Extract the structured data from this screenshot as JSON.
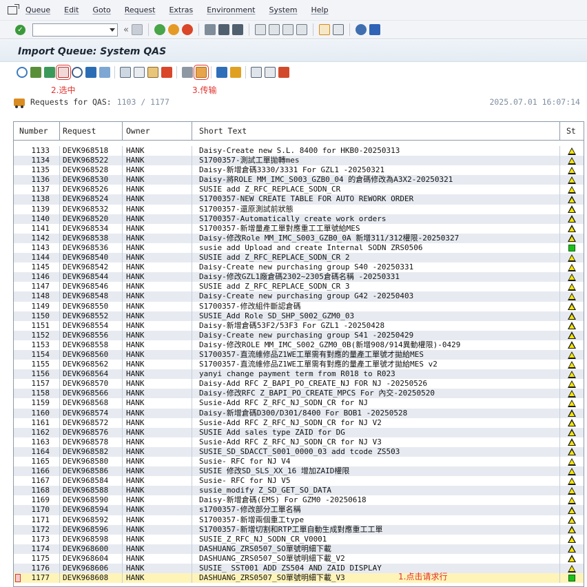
{
  "menu": [
    "Queue",
    "Edit",
    "Goto",
    "Request",
    "Extras",
    "Environment",
    "System",
    "Help"
  ],
  "toolbar": {
    "command_value": "",
    "back_glyph": "«"
  },
  "screen_title": "Import Queue: System QAS",
  "annotations": {
    "select": "2.选中",
    "transport": "3.传输",
    "click_row": "1.点击请求行"
  },
  "requests_line": {
    "label": "Requests for QAS:",
    "count": "1103 / 1177"
  },
  "timestamp": "2025.07.01 16:07:14",
  "grid": {
    "headers": {
      "number": "Number",
      "request": "Request",
      "owner": "Owner",
      "short_text": "Short Text",
      "status": "St"
    },
    "rows": [
      {
        "n": "1133",
        "req": "DEVK968518",
        "owner": "HANK",
        "text": "Daisy-Create new S.L. 8400 for HKB0-20250313",
        "st": "warn"
      },
      {
        "n": "1134",
        "req": "DEVK968522",
        "owner": "HANK",
        "text": "S1700357-測試工單拋轉mes",
        "st": "warn"
      },
      {
        "n": "1135",
        "req": "DEVK968528",
        "owner": "HANK",
        "text": "Daisy-新增倉碼3330/3331 For GZL1 -20250321",
        "st": "warn"
      },
      {
        "n": "1136",
        "req": "DEVK968530",
        "owner": "HANK",
        "text": "Daisy-將ROLE MM_IMC_S003_GZB0_04 的倉碼修改為A3X2-20250321",
        "st": "warn"
      },
      {
        "n": "1137",
        "req": "DEVK968526",
        "owner": "HANK",
        "text": "SUSIE add Z_RFC_REPLACE_SODN_CR",
        "st": "warn"
      },
      {
        "n": "1138",
        "req": "DEVK968524",
        "owner": "HANK",
        "text": "S1700357-NEW CREATE TABLE FOR AUTO REWORK ORDER",
        "st": "warn"
      },
      {
        "n": "1139",
        "req": "DEVK968532",
        "owner": "HANK",
        "text": "S1700357-還原測試前狀態",
        "st": "warn"
      },
      {
        "n": "1140",
        "req": "DEVK968520",
        "owner": "HANK",
        "text": "S1700357-Automatically create work orders",
        "st": "warn"
      },
      {
        "n": "1141",
        "req": "DEVK968534",
        "owner": "HANK",
        "text": "S1700357-新增量產工單對應重工工單號給MES",
        "st": "warn"
      },
      {
        "n": "1142",
        "req": "DEVK968538",
        "owner": "HANK",
        "text": "Daisy-修改Role MM_IMC_S003_GZB0_0A 新增311/312權限-20250327",
        "st": "warn"
      },
      {
        "n": "1143",
        "req": "DEVK968536",
        "owner": "HANK",
        "text": "susie add Upload and create Internal SODN ZRS0506",
        "st": "ok"
      },
      {
        "n": "1144",
        "req": "DEVK968540",
        "owner": "HANK",
        "text": " SUSIE add Z_RFC_REPLACE_SODN_CR 2",
        "st": "warn"
      },
      {
        "n": "1145",
        "req": "DEVK968542",
        "owner": "HANK",
        "text": "Daisy-Create new purchasing group S40 -20250331",
        "st": "warn"
      },
      {
        "n": "1146",
        "req": "DEVK968544",
        "owner": "HANK",
        "text": "Daisy-修改GZL1廠倉碼2302~2305倉碼名稱 -20250331",
        "st": "warn"
      },
      {
        "n": "1147",
        "req": "DEVK968546",
        "owner": "HANK",
        "text": "SUSIE add Z_RFC_REPLACE_SODN_CR 3",
        "st": "warn"
      },
      {
        "n": "1148",
        "req": "DEVK968548",
        "owner": "HANK",
        "text": "Daisy-Create new purchasing group G42 -20250403",
        "st": "warn"
      },
      {
        "n": "1149",
        "req": "DEVK968550",
        "owner": "HANK",
        "text": "S1700357-修改組件斷認倉碼",
        "st": "warn"
      },
      {
        "n": "1150",
        "req": "DEVK968552",
        "owner": "HANK",
        "text": "SUSIE_Add Role SD_SHP_S002_GZM0_03",
        "st": "warn"
      },
      {
        "n": "1151",
        "req": "DEVK968554",
        "owner": "HANK",
        "text": "Daisy-新增倉碼53F2/53F3 For GZL1 -20250428",
        "st": "warn"
      },
      {
        "n": "1152",
        "req": "DEVK968556",
        "owner": "HANK",
        "text": "Daisy-Create new purchasing group S41 -20250429",
        "st": "warn"
      },
      {
        "n": "1153",
        "req": "DEVK968558",
        "owner": "HANK",
        "text": "Daisy-修改ROLE MM_IMC_S002_GZM0_0B(新增908/914異動權限)-0429",
        "st": "warn"
      },
      {
        "n": "1154",
        "req": "DEVK968560",
        "owner": "HANK",
        "text": "S1700357-直流維修品Z1WE工單需有對應的量產工單號才拋給MES",
        "st": "warn"
      },
      {
        "n": "1155",
        "req": "DEVK968562",
        "owner": "HANK",
        "text": "S1700357-直流維修品Z1WE工單需有對應的量產工單號才拋給MES v2",
        "st": "warn"
      },
      {
        "n": "1156",
        "req": "DEVK968564",
        "owner": "HANK",
        "text": "yanyi change payment term from R018 to R023",
        "st": "warn"
      },
      {
        "n": "1157",
        "req": "DEVK968570",
        "owner": "HANK",
        "text": "Daisy-Add RFC Z_BAPI_PO_CREATE_NJ FOR NJ -20250526",
        "st": "warn"
      },
      {
        "n": "1158",
        "req": "DEVK968566",
        "owner": "HANK",
        "text": "Daisy-修改RFC  Z_BAPI_PO_CREATE_MPCS  For 內交-20250520",
        "st": "warn"
      },
      {
        "n": "1159",
        "req": "DEVK968568",
        "owner": "HANK",
        "text": "Susie-Add RFC Z_RFC_NJ_SODN_CR for NJ",
        "st": "warn"
      },
      {
        "n": "1160",
        "req": "DEVK968574",
        "owner": "HANK",
        "text": "Daisy-新增倉碼D300/D301/8400 For BOB1 -20250528",
        "st": "warn"
      },
      {
        "n": "1161",
        "req": "DEVK968572",
        "owner": "HANK",
        "text": "Susie-Add RFC Z_RFC_NJ_SODN_CR for NJ V2",
        "st": "warn"
      },
      {
        "n": "1162",
        "req": "DEVK968576",
        "owner": "HANK",
        "text": "SUSIE Add sales type ZAID for DG",
        "st": "warn"
      },
      {
        "n": "1163",
        "req": "DEVK968578",
        "owner": "HANK",
        "text": "Susie-Add RFC Z_RFC_NJ_SODN_CR for NJ V3",
        "st": "warn"
      },
      {
        "n": "1164",
        "req": "DEVK968582",
        "owner": "HANK",
        "text": "SUSIE_SD_SDACCT_S001_0000_03 add tcode ZS503",
        "st": "warn"
      },
      {
        "n": "1165",
        "req": "DEVK968580",
        "owner": "HANK",
        "text": "Susie- RFC for NJ V4",
        "st": "warn"
      },
      {
        "n": "1166",
        "req": "DEVK968586",
        "owner": "HANK",
        "text": "SUSIE 修改SD_SLS_XX_16 增加ZAID權限",
        "st": "warn"
      },
      {
        "n": "1167",
        "req": "DEVK968584",
        "owner": "HANK",
        "text": "Susie- RFC for NJ V5",
        "st": "warn"
      },
      {
        "n": "1168",
        "req": "DEVK968588",
        "owner": "HANK",
        "text": "susie_modify Z_SD_GET_SO_DATA",
        "st": "warn"
      },
      {
        "n": "1169",
        "req": "DEVK968590",
        "owner": "HANK",
        "text": "Daisy-新增倉碼(EMS) For GZM0 -20250618",
        "st": "warn"
      },
      {
        "n": "1170",
        "req": "DEVK968594",
        "owner": "HANK",
        "text": "s1700357-修改部分工單名稱",
        "st": "warn"
      },
      {
        "n": "1171",
        "req": "DEVK968592",
        "owner": "HANK",
        "text": "S1700357-新增兩個重工type",
        "st": "warn"
      },
      {
        "n": "1172",
        "req": "DEVK968596",
        "owner": "HANK",
        "text": "S1700357-新增切割和RTP工單自動生成對應重工工單",
        "st": "warn"
      },
      {
        "n": "1173",
        "req": "DEVK968598",
        "owner": "HANK",
        "text": "SUSIE_Z_RFC_NJ_SODN_CR_V0001",
        "st": "warn"
      },
      {
        "n": "1174",
        "req": "DEVK968600",
        "owner": "HANK",
        "text": "DASHUANG_ZRS0507_SO單號明細下載",
        "st": "warn"
      },
      {
        "n": "1175",
        "req": "DEVK968604",
        "owner": "HANK",
        "text": "DASHUANG_ZRS0507_SO單號明細下載_V2",
        "st": "warn"
      },
      {
        "n": "1176",
        "req": "DEVK968606",
        "owner": "HANK",
        "text": "SUSIE_ SST001 ADD ZS504 AND ZAID DISPLAY",
        "st": "warn"
      },
      {
        "n": "1177",
        "req": "DEVK968608",
        "owner": "HANK",
        "text": "DASHUANG_ZRS0507_SO單號明細下載_V3",
        "st": "ok",
        "current": true
      }
    ]
  }
}
